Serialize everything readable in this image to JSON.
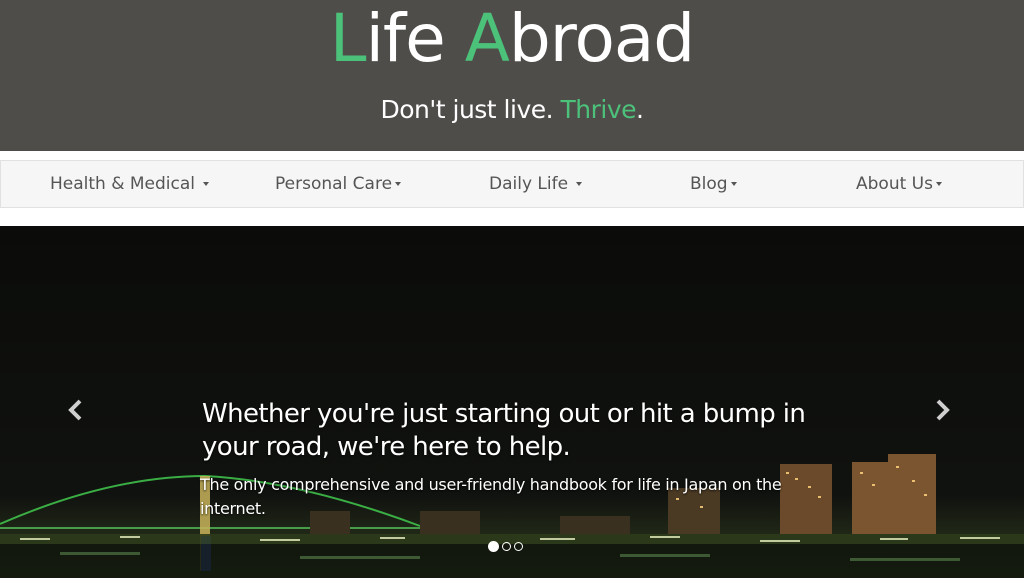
{
  "header": {
    "title_parts": [
      "L",
      "ife ",
      "A",
      "broad"
    ],
    "tagline_parts": [
      "Don't just live. ",
      "Thrive",
      "."
    ]
  },
  "nav": {
    "items": [
      {
        "label": "Health & Medical"
      },
      {
        "label": "Personal Care"
      },
      {
        "label": "Daily Life"
      },
      {
        "label": "Blog"
      },
      {
        "label": "About Us"
      }
    ]
  },
  "carousel": {
    "heading": "Whether you're just starting out or hit a bump in your road, we're here to help.",
    "subheading": "The only comprehensive and user-friendly handbook for life in Japan on the internet.",
    "prev_icon": "chevron-left-icon",
    "next_icon": "chevron-right-icon",
    "active_slide": 1,
    "slide_count": 3
  },
  "colors": {
    "header_bg": "#4f4d4a",
    "accent": "#4cc17a",
    "nav_bg": "#f6f6f6",
    "nav_text": "#555555"
  }
}
